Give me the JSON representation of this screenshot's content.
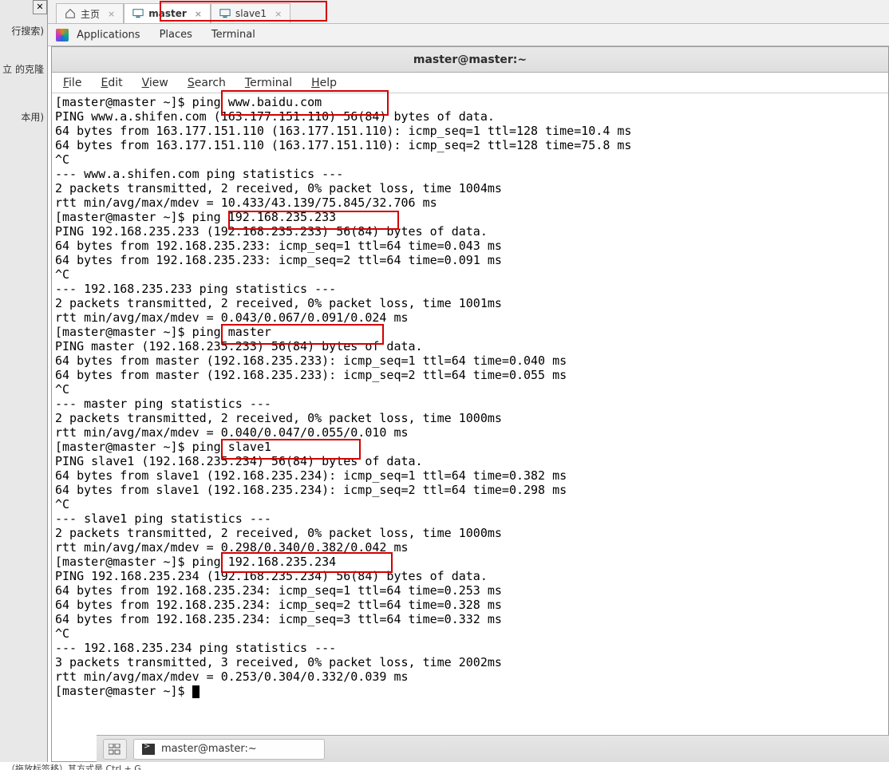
{
  "left_panel": {
    "t1": "行搜索)",
    "t2": "立 的克隆",
    "t3": "本用)"
  },
  "outer_tabs": {
    "home": "主页",
    "master": "master",
    "slave1": "slave1"
  },
  "gnome": {
    "applications": "Applications",
    "places": "Places",
    "terminal": "Terminal"
  },
  "terminal": {
    "title": "master@master:~",
    "menu": {
      "file": "File",
      "edit": "Edit",
      "view": "View",
      "search": "Search",
      "terminal": "Terminal",
      "help": "Help"
    },
    "lines": [
      "[master@master ~]$ ping www.baidu.com",
      "PING www.a.shifen.com (163.177.151.110) 56(84) bytes of data.",
      "64 bytes from 163.177.151.110 (163.177.151.110): icmp_seq=1 ttl=128 time=10.4 ms",
      "64 bytes from 163.177.151.110 (163.177.151.110): icmp_seq=2 ttl=128 time=75.8 ms",
      "^C",
      "--- www.a.shifen.com ping statistics ---",
      "2 packets transmitted, 2 received, 0% packet loss, time 1004ms",
      "rtt min/avg/max/mdev = 10.433/43.139/75.845/32.706 ms",
      "[master@master ~]$ ping 192.168.235.233",
      "PING 192.168.235.233 (192.168.235.233) 56(84) bytes of data.",
      "64 bytes from 192.168.235.233: icmp_seq=1 ttl=64 time=0.043 ms",
      "64 bytes from 192.168.235.233: icmp_seq=2 ttl=64 time=0.091 ms",
      "^C",
      "--- 192.168.235.233 ping statistics ---",
      "2 packets transmitted, 2 received, 0% packet loss, time 1001ms",
      "rtt min/avg/max/mdev = 0.043/0.067/0.091/0.024 ms",
      "[master@master ~]$ ping master",
      "PING master (192.168.235.233) 56(84) bytes of data.",
      "64 bytes from master (192.168.235.233): icmp_seq=1 ttl=64 time=0.040 ms",
      "64 bytes from master (192.168.235.233): icmp_seq=2 ttl=64 time=0.055 ms",
      "^C",
      "--- master ping statistics ---",
      "2 packets transmitted, 2 received, 0% packet loss, time 1000ms",
      "rtt min/avg/max/mdev = 0.040/0.047/0.055/0.010 ms",
      "[master@master ~]$ ping slave1",
      "PING slave1 (192.168.235.234) 56(84) bytes of data.",
      "64 bytes from slave1 (192.168.235.234): icmp_seq=1 ttl=64 time=0.382 ms",
      "64 bytes from slave1 (192.168.235.234): icmp_seq=2 ttl=64 time=0.298 ms",
      "^C",
      "--- slave1 ping statistics ---",
      "2 packets transmitted, 2 received, 0% packet loss, time 1000ms",
      "rtt min/avg/max/mdev = 0.298/0.340/0.382/0.042 ms",
      "[master@master ~]$ ping 192.168.235.234",
      "PING 192.168.235.234 (192.168.235.234) 56(84) bytes of data.",
      "64 bytes from 192.168.235.234: icmp_seq=1 ttl=64 time=0.253 ms",
      "64 bytes from 192.168.235.234: icmp_seq=2 ttl=64 time=0.328 ms",
      "64 bytes from 192.168.235.234: icmp_seq=3 ttl=64 time=0.332 ms",
      "^C",
      "--- 192.168.235.234 ping statistics ---",
      "3 packets transmitted, 3 received, 0% packet loss, time 2002ms",
      "rtt min/avg/max/mdev = 0.253/0.304/0.332/0.039 ms",
      "[master@master ~]$ "
    ]
  },
  "taskbar": {
    "task1": "master@master:~"
  },
  "bottom_strip": "（拖放标签移）其方式是 Ctrl + G"
}
